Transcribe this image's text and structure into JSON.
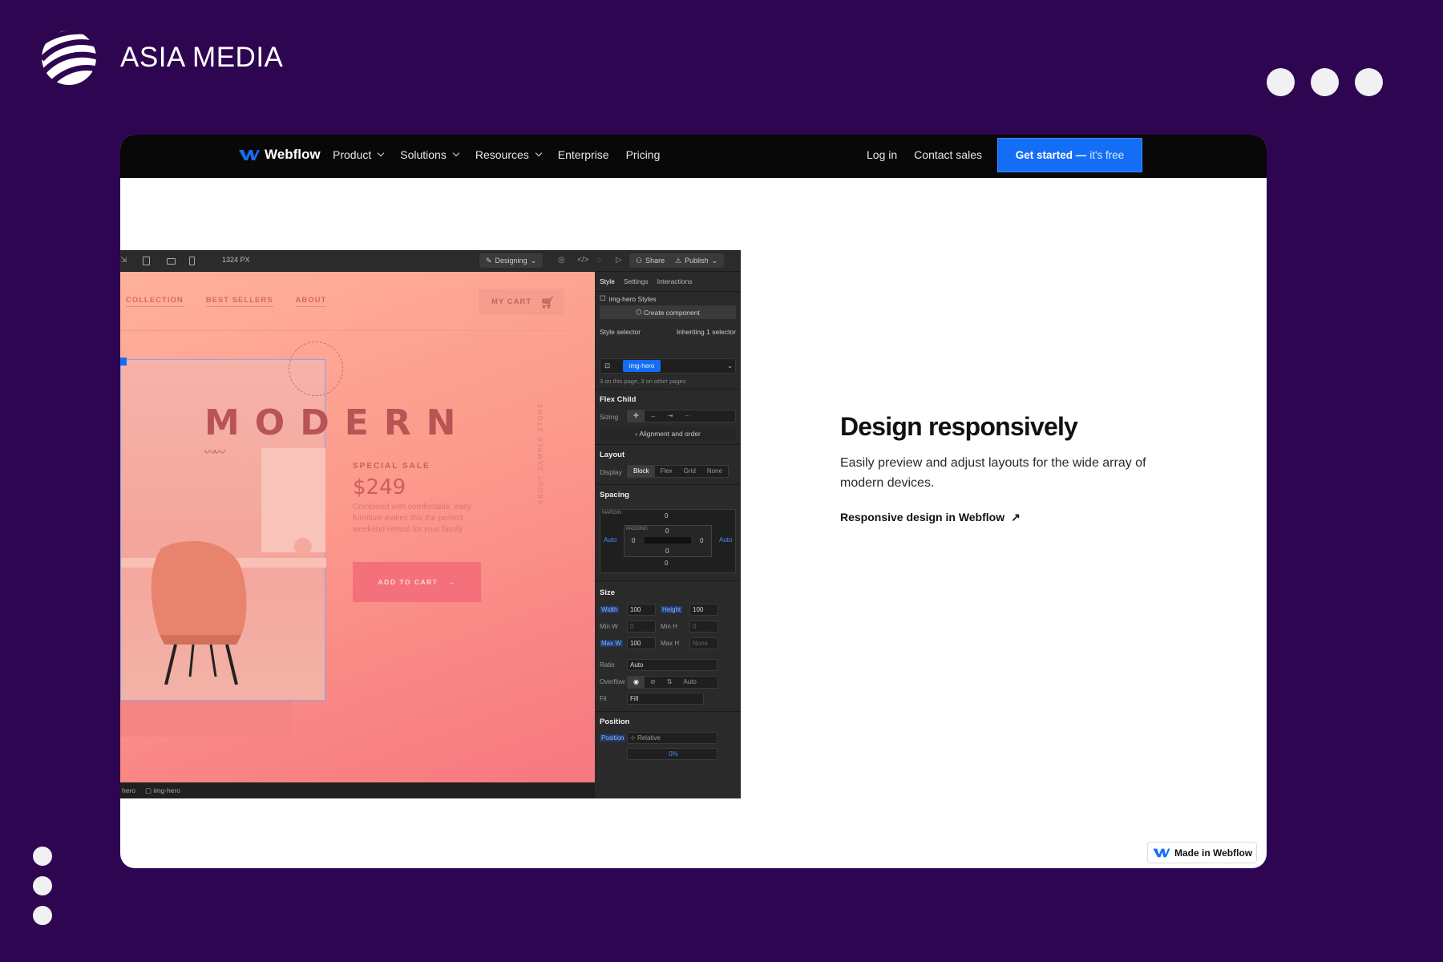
{
  "brand": {
    "name": "ASIA MEDIA"
  },
  "webflow_nav": {
    "logo_text": "Webflow",
    "menu": [
      "Product",
      "Solutions",
      "Resources",
      "Enterprise",
      "Pricing"
    ],
    "login": "Log in",
    "contact": "Contact sales",
    "cta_bold": "Get started —",
    "cta_light": "it's free",
    "accent": "#146ef5"
  },
  "designer": {
    "width_readout": "1324 PX",
    "mode": "Designing",
    "share": "Share",
    "publish": "Publish",
    "canvas": {
      "nav": [
        "COLLECTION",
        "BEST SELLERS",
        "ABOUT"
      ],
      "cart": "MY CART",
      "title": "MODERN",
      "sale_label": "SPECIAL SALE",
      "price": "$249",
      "description": "Combined with comfortable, easy furniture makes this the perfect weekend retreat for your family",
      "add_to_cart": "ADD TO CART",
      "vertical": "ABOUT SAMPLE STORE"
    },
    "status": {
      "crumb1": "hero",
      "crumb2": "img-hero"
    },
    "panel": {
      "tabs": [
        "Style",
        "Settings",
        "Interactions"
      ],
      "styles_label": "img-hero Styles",
      "create_component": "Create component",
      "style_selector": "Style selector",
      "inheriting": "Inheriting 1 selector",
      "chip": "img-hero",
      "on_page": "3 on this page, 3 on other pages",
      "flex_child": "Flex Child",
      "sizing": "Sizing",
      "alignment": "Alignment and order",
      "layout": "Layout",
      "display": "Display",
      "display_opts": [
        "Block",
        "Flex",
        "Grid",
        "None"
      ],
      "spacing": "Spacing",
      "margin_label": "MARGIN",
      "padding_label": "PADDING",
      "zero": "0",
      "auto": "Auto",
      "size": "Size",
      "width_label": "Width",
      "width_val": "100",
      "height_label": "Height",
      "height_val": "100",
      "minw": "Min W",
      "minh": "Min H",
      "maxw": "Max W",
      "maxw_val": "100",
      "maxh": "Max H",
      "none": "None",
      "ratio": "Ratio",
      "overflow": "Overflow",
      "fit": "Fit",
      "fill": "Fill",
      "position": "Position",
      "relative": "Relative",
      "pct": "0%"
    }
  },
  "feature": {
    "heading": "Design responsively",
    "body": "Easily preview and adjust layouts for the wide array of modern devices.",
    "link": "Responsive design in Webflow"
  },
  "badge": {
    "text": "Made in Webflow"
  }
}
